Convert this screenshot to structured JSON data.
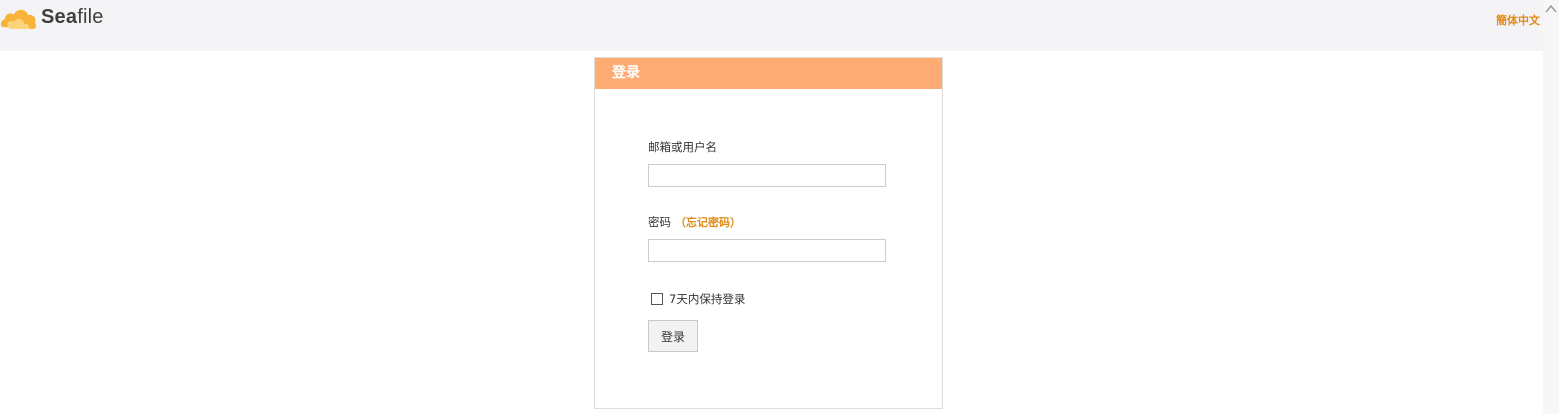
{
  "app": {
    "logo_text_strong": "Sea",
    "logo_text_rest": "file",
    "language_link": "簡体中文"
  },
  "login": {
    "title": "登录",
    "username_label": "邮箱或用户名",
    "username_value": "",
    "password_label": "密码",
    "forgot_password": "（忘记密码）",
    "password_value": "",
    "remember_label": "7天内保持登录",
    "remember_checked": false,
    "submit_label": "登录"
  },
  "colors": {
    "accent": "#feac74",
    "link": "#e08c1a",
    "header_bg": "#f4f4f6"
  }
}
